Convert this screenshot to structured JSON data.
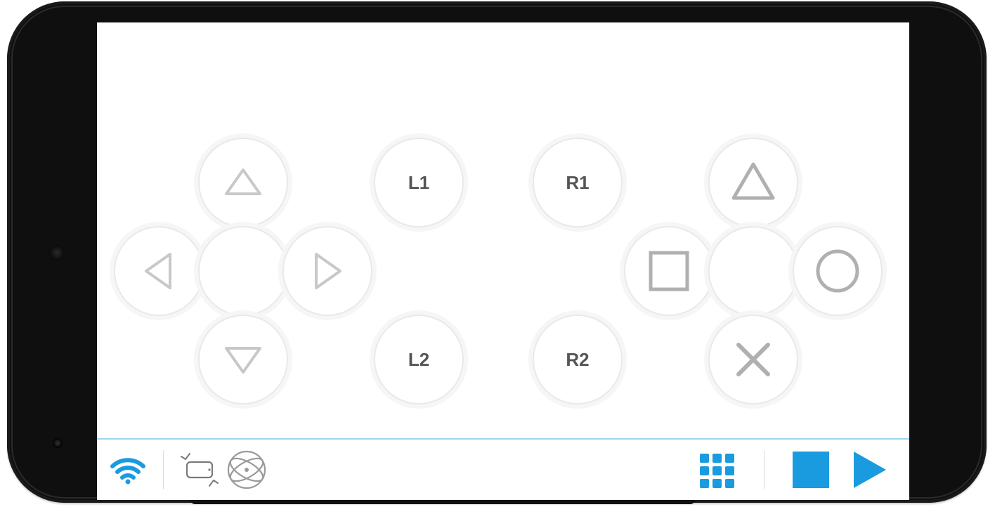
{
  "controller": {
    "dpad": {
      "up": "up",
      "down": "down",
      "left": "left",
      "right": "right",
      "center": "center"
    },
    "shoulder": {
      "l1": "L1",
      "l2": "L2",
      "r1": "R1",
      "r2": "R2"
    },
    "face": {
      "triangle": "triangle",
      "square": "square",
      "circle": "circle",
      "cross": "cross",
      "center": "center"
    }
  },
  "toolbar": {
    "wifi": "wifi",
    "rotate": "rotate",
    "atom": "sensor",
    "grid": "grid",
    "stop": "stop",
    "play": "play"
  },
  "colors": {
    "accent": "#1a9be0",
    "outline": "#c8c8c8"
  }
}
